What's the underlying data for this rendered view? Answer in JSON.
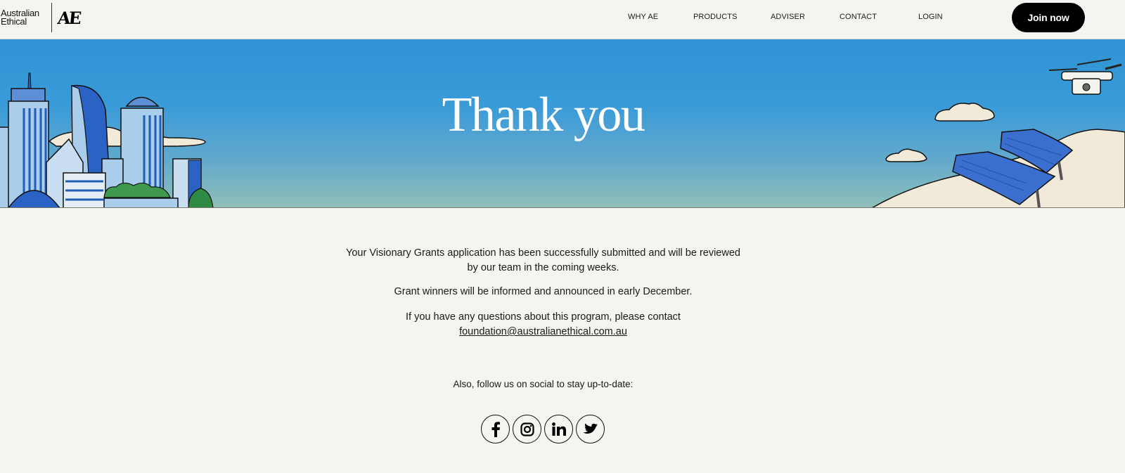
{
  "header": {
    "logo": {
      "line1": "Australian",
      "line2": "Ethical",
      "mark": "AE"
    },
    "nav": [
      {
        "label": "WHY AE"
      },
      {
        "label": "PRODUCTS"
      },
      {
        "label": "ADVISER"
      },
      {
        "label": "CONTACT"
      },
      {
        "label": "LOGIN"
      }
    ],
    "cta_label": "Join now"
  },
  "hero": {
    "title": "Thank you",
    "colors": {
      "sky_top": "#2f93d4",
      "sky_bottom": "#8fbfb8"
    }
  },
  "main": {
    "paragraph1_line1": "Your Visionary Grants application has been successfully submitted and will be reviewed",
    "paragraph1_line2": "by our team in the coming weeks.",
    "paragraph2": "Grant winners will be informed and announced in early December.",
    "paragraph3_line1": "If you have any questions about this program, please contact",
    "email": "foundation@australianethical.com.au",
    "social_prompt": "Also, follow us on social to stay up-to-date:",
    "social": [
      {
        "name": "facebook",
        "icon": "facebook-icon"
      },
      {
        "name": "instagram",
        "icon": "instagram-icon"
      },
      {
        "name": "linkedin",
        "icon": "linkedin-icon"
      },
      {
        "name": "twitter",
        "icon": "twitter-icon"
      }
    ]
  }
}
